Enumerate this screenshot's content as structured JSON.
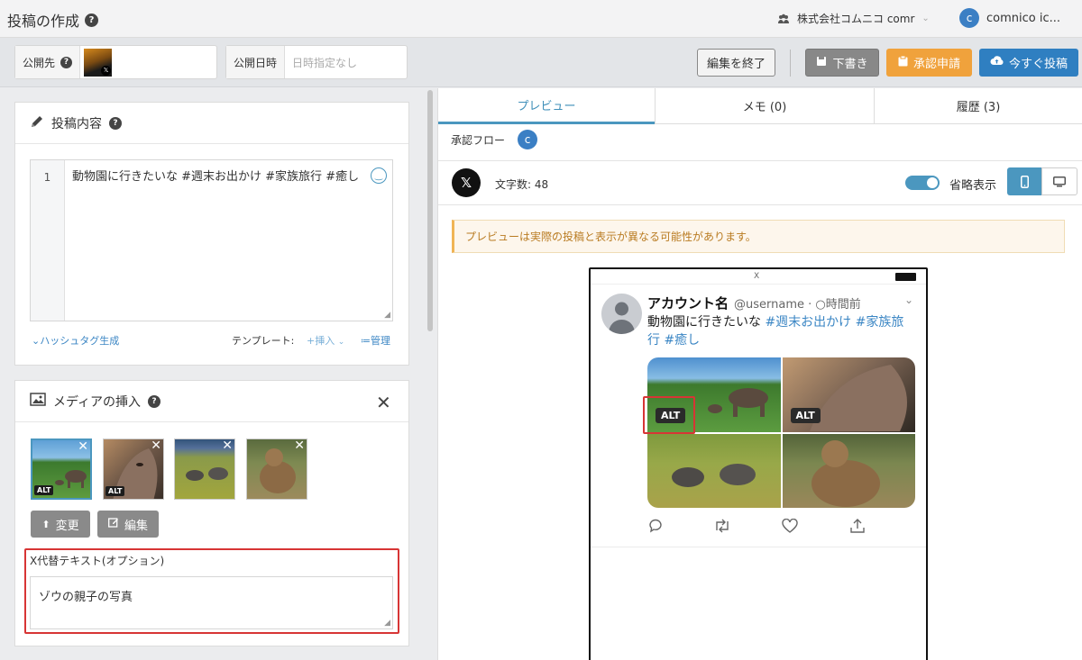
{
  "header": {
    "title": "投稿の作成",
    "company": "株式会社コムニコ comr",
    "user_initial": "c",
    "user_name": "comnico ic..."
  },
  "toolbar": {
    "publish_to_label": "公開先",
    "publish_time_label": "公開日時",
    "publish_time_placeholder": "日時指定なし",
    "end_edit": "編集を終了",
    "draft": "下書き",
    "approval": "承認申請",
    "post_now": "今すぐ投稿"
  },
  "post": {
    "section_title": "投稿内容",
    "line_number": "1",
    "text": "動物園に行きたいな #週末お出かけ #家族旅行 #癒し",
    "hashtag_gen": "ハッシュタグ生成",
    "template_label": "テンプレート:",
    "insert": "挿入",
    "manage": "管理"
  },
  "media": {
    "section_title": "メディアの挿入",
    "alt_badge": "ALT",
    "change": "変更",
    "edit": "編集",
    "alt_label": "X代替テキスト(オプション)",
    "alt_value": "ゾウの親子の写真"
  },
  "tabs": {
    "preview": "プレビュー",
    "memo": "メモ (0)",
    "history": "履歴 (3)"
  },
  "preview": {
    "approval_flow": "承認フロー",
    "flow_initial": "c",
    "char_count": "文字数: 48",
    "abbrev": "省略表示",
    "warning": "プレビューは実際の投稿と表示が異なる可能性があります。",
    "status_center": "X",
    "account_name": "アカウント名",
    "handle": "@username · ○時間前",
    "tweet_text_plain": "動物園に行きたいな ",
    "tweet_tags_1": "#週末お出かけ #家族旅",
    "tweet_tags_2": "行 #癒し",
    "alt_badge": "ALT"
  },
  "colors": {
    "accent": "#2f7fc1",
    "tab_accent": "#4b97bf",
    "approval": "#f0a23c",
    "highlight": "#d73535"
  }
}
